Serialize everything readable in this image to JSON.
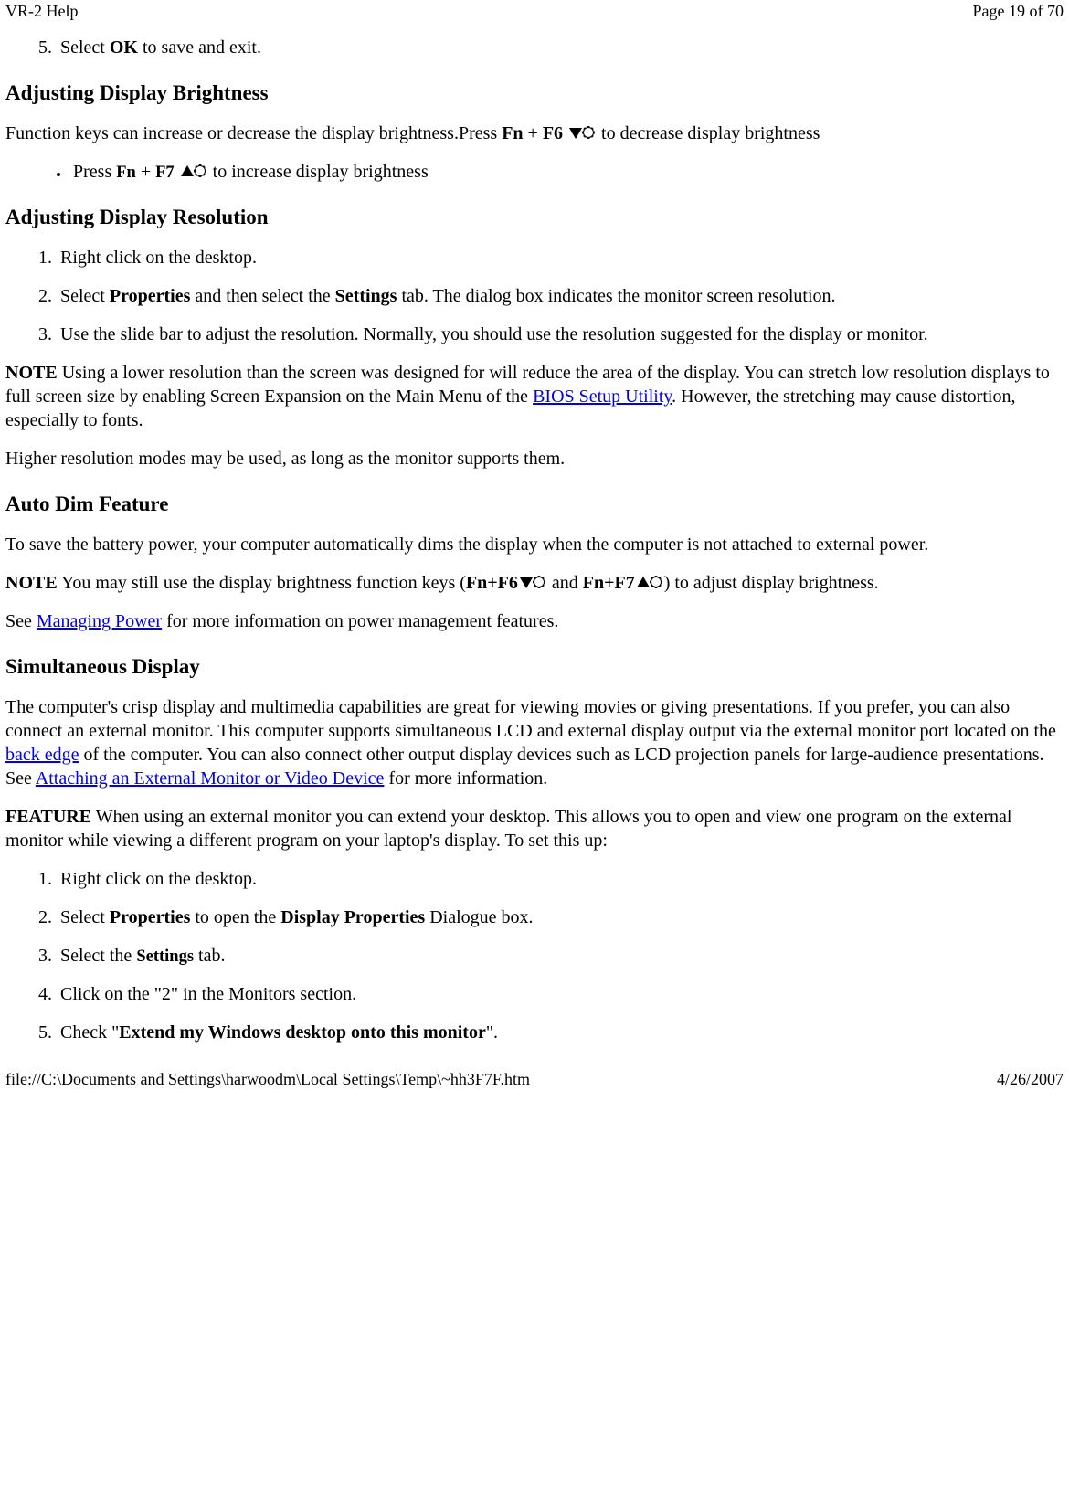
{
  "header": {
    "title": "VR-2 Help",
    "pagenum": "Page 19 of 70"
  },
  "step5_pre": "Select ",
  "step5_bold": "OK",
  "step5_post": " to save and exit.",
  "h_brightness": "Adjusting Display Brightness",
  "p_brightness_pre": "Function keys can increase or decrease the display brightness.Press ",
  "p_brightness_k1": "Fn",
  "p_brightness_plus": " + ",
  "p_brightness_k2": "F6",
  "p_brightness_post": " to decrease display brightness",
  "li_brightness_pre": "Press ",
  "li_brightness_k1": "Fn",
  "li_brightness_plus": " + ",
  "li_brightness_k2": "F7",
  "li_brightness_post": " to increase display brightness",
  "h_resolution": "Adjusting Display Resolution",
  "res_li1": "Right click on the desktop.",
  "res_li2_pre": "Select ",
  "res_li2_b1": "Properties",
  "res_li2_mid": " and then select the ",
  "res_li2_b2": "Settings",
  "res_li2_post": " tab. The dialog box indicates the monitor screen resolution.",
  "res_li3": "Use the slide bar to adjust the resolution. Normally, you should use the resolution suggested for the display or monitor.",
  "note1_label": "NOTE",
  "note1_pre": "  Using a lower resolution than the screen was designed for will reduce the area of the display. You can stretch low resolution displays to full screen size by enabling Screen Expansion on the Main Menu of the ",
  "note1_link": "BIOS Setup Utility",
  "note1_post": ". However, the stretching may cause distortion, especially to fonts.",
  "p_higher": "Higher resolution modes may be used, as long as the monitor supports them.",
  "h_autodim": "Auto Dim Feature",
  "p_autodim": "To save the battery power, your computer automatically dims the display when the computer is not attached to external power.",
  "note2_label": "NOTE",
  "note2_pre": "  You may still use the display brightness function keys (",
  "note2_k1": "Fn+F6",
  "note2_and": " and ",
  "note2_k2": "Fn+F7",
  "note2_post": ") to adjust display brightness.",
  "p_see_pre": "See ",
  "p_see_link": "Managing Power",
  "p_see_post": " for more information on power management features.",
  "h_simul": "Simultaneous Display",
  "p_simul_pre": "The computer's crisp display and multimedia capabilities are great for viewing movies or giving presentations. If you prefer, you can also connect an external monitor. This computer supports simultaneous LCD and external display output via the external monitor port located on the ",
  "p_simul_link1": "back edge",
  "p_simul_mid": " of the computer.  You can also connect other output display devices such as LCD projection panels for large-audience presentations. See ",
  "p_simul_link2": "Attaching an External Monitor or Video Device",
  "p_simul_post": " for more information.",
  "feature_label": "FEATURE",
  "feature_text": "  When using an external monitor you can extend your desktop. This allows you to open and view one program on the external monitor while viewing a different program on your laptop's display. To set this up:",
  "sim_li1": "Right click on the desktop.",
  "sim_li2_pre": "Select ",
  "sim_li2_b1": "Properties",
  "sim_li2_mid": " to open the ",
  "sim_li2_b2": "Display Properties",
  "sim_li2_post": " Dialogue box.",
  "sim_li3_pre": "Select the ",
  "sim_li3_b": "Settings",
  "sim_li3_post": " tab.",
  "sim_li4": "Click on the \"2\" in the Monitors section.",
  "sim_li5_pre": "Check \"",
  "sim_li5_b": "Extend my Windows desktop onto this monitor",
  "sim_li5_post": "\".",
  "footer": {
    "path": "file://C:\\Documents and Settings\\harwoodm\\Local Settings\\Temp\\~hh3F7F.htm",
    "date": "4/26/2007"
  }
}
